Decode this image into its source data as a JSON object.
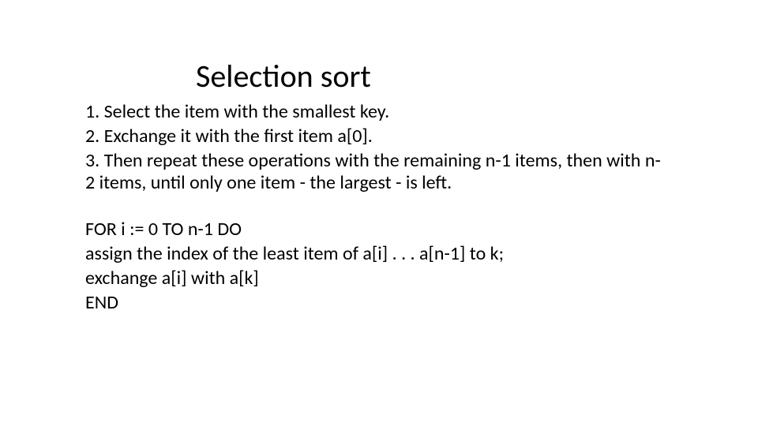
{
  "title": "Selection sort",
  "steps": {
    "s1": "1. Select the item with the smallest key.",
    "s2": "2. Exchange it with the first item a[0].",
    "s3": "3. Then repeat these operations with the remaining n-1 items, then with n-2 items, until only one item - the largest - is left."
  },
  "pseudocode": {
    "l1": "FOR i := 0 TO n-1 DO",
    "l2": "assign the index of the least item of a[i] . . . a[n-1] to k;",
    "l3": "exchange a[i] with a[k]",
    "l4": "END"
  }
}
